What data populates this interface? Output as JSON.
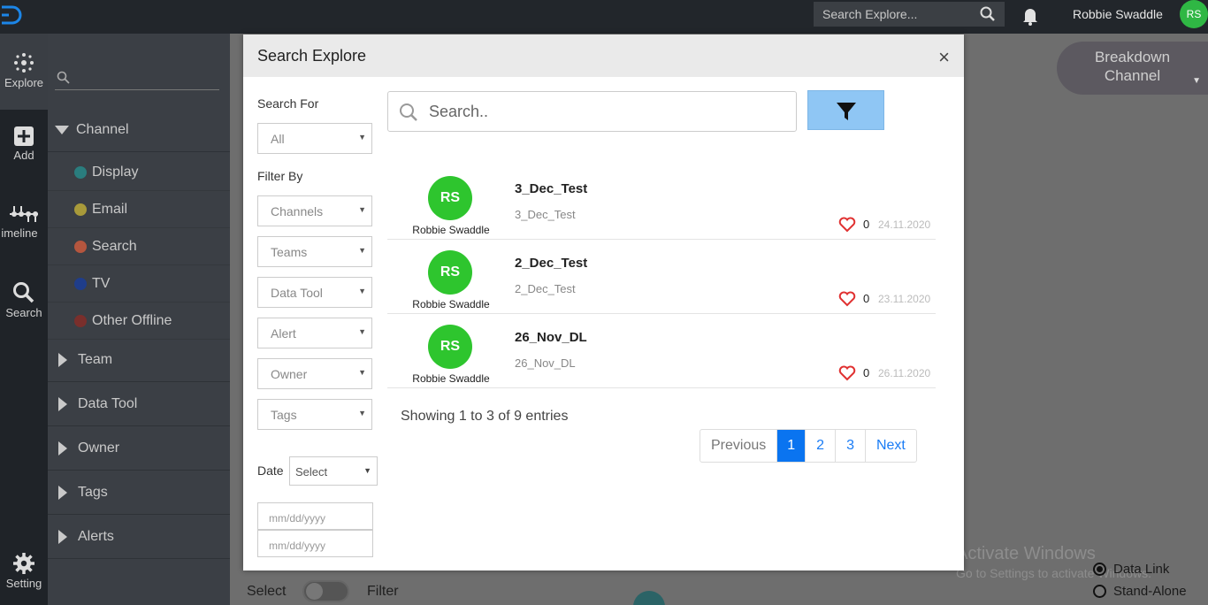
{
  "topbar": {
    "search_placeholder": "Search Explore...",
    "user_name": "Robbie Swaddle",
    "user_initials": "RS"
  },
  "rail": {
    "items": [
      {
        "label": "Explore",
        "icon": "explore-icon"
      },
      {
        "label": "Add",
        "icon": "add-icon"
      },
      {
        "label": "imeline",
        "icon": "timeline-icon"
      },
      {
        "label": "Search",
        "icon": "search-icon"
      },
      {
        "label": "Setting",
        "icon": "gear-icon"
      }
    ]
  },
  "sidebar": {
    "channel_label": "Channel",
    "channels": [
      {
        "label": "Display",
        "color": "#2a7d7e"
      },
      {
        "label": "Email",
        "color": "#a89a3a"
      },
      {
        "label": "Search",
        "color": "#b5563e"
      },
      {
        "label": "TV",
        "color": "#1f3d8a"
      },
      {
        "label": "Other Offline",
        "color": "#7a2f2c"
      }
    ],
    "groups": [
      "Team",
      "Data Tool",
      "Owner",
      "Tags",
      "Alerts"
    ]
  },
  "background": {
    "breakdown_line1": "Breakdown",
    "breakdown_line2": "Channel",
    "select_label": "Select",
    "filter_label": "Filter",
    "activate_title": "Activate Windows",
    "activate_sub": "Go to Settings to activate Windows.",
    "radio_data_link": "Data Link",
    "radio_standalone": "Stand-Alone"
  },
  "modal": {
    "title": "Search Explore",
    "search_for_label": "Search For",
    "search_for_value": "All",
    "filter_by_label": "Filter By",
    "filters": [
      "Channels",
      "Teams",
      "Data Tool",
      "Alert",
      "Owner",
      "Tags"
    ],
    "date_label": "Date",
    "date_select": "Select",
    "date_from_placeholder": "mm/dd/yyyy",
    "date_to_placeholder": "mm/dd/yyyy",
    "search_placeholder": "Search..",
    "results": [
      {
        "initials": "RS",
        "owner": "Robbie Swaddle",
        "title": "3_Dec_Test",
        "subtitle": "3_Dec_Test",
        "likes": "0",
        "date": "24.11.2020"
      },
      {
        "initials": "RS",
        "owner": "Robbie Swaddle",
        "title": "2_Dec_Test",
        "subtitle": "2_Dec_Test",
        "likes": "0",
        "date": "23.11.2020"
      },
      {
        "initials": "RS",
        "owner": "Robbie Swaddle",
        "title": "26_Nov_DL",
        "subtitle": "26_Nov_DL",
        "likes": "0",
        "date": "26.11.2020"
      }
    ],
    "entries_text": "Showing 1 to 3 of 9 entries",
    "pager": {
      "previous": "Previous",
      "pages": [
        "1",
        "2",
        "3"
      ],
      "next": "Next"
    }
  }
}
